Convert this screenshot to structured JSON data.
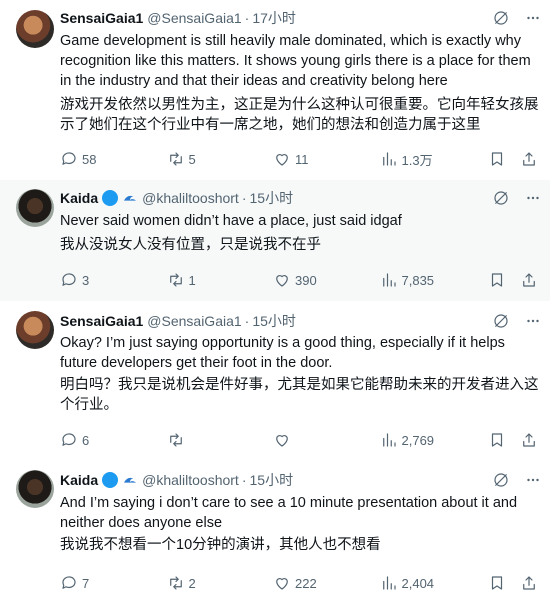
{
  "tweets": [
    {
      "name": "SensaiGaia1",
      "handle": "@SensaiGaia1",
      "dot": "·",
      "time": "17小时",
      "verified": false,
      "text": "Game development is still heavily male dominated, which is exactly why recognition like this matters. It shows young girls there is a place for them in the industry and that their ideas and creativity belong here",
      "translation": "游戏开发依然以男性为主，这正是为什么这种认可很重要。它向年轻女孩展示了她们在这个行业中有一席之地，她们的想法和创造力属于这里",
      "replies": "58",
      "retweets": "5",
      "likes": "11",
      "views": "1.3万"
    },
    {
      "name": "Kaida",
      "handle": "@khaliltooshort",
      "dot": "·",
      "time": "15小时",
      "verified": true,
      "text": "Never said women didn’t have a place, just said idgaf",
      "translation": "我从没说女人没有位置，只是说我不在乎",
      "replies": "3",
      "retweets": "1",
      "likes": "390",
      "views": "7,835"
    },
    {
      "name": "SensaiGaia1",
      "handle": "@SensaiGaia1",
      "dot": "·",
      "time": "15小时",
      "verified": false,
      "text": "Okay? I’m just saying opportunity is a good thing, especially if it helps future developers get their foot in the door.",
      "translation": "明白吗？我只是说机会是件好事，尤其是如果它能帮助未来的开发者进入这个行业。",
      "replies": "6",
      "retweets": "",
      "likes": "",
      "views": "2,769"
    },
    {
      "name": "Kaida",
      "handle": "@khaliltooshort",
      "dot": "·",
      "time": "15小时",
      "verified": true,
      "text": "And I’m saying i don’t care to see a 10 minute presentation about it and neither does anyone else",
      "translation": "我说我不想看一个10分钟的演讲，其他人也不想看",
      "replies": "7",
      "retweets": "2",
      "likes": "222",
      "views": "2,404"
    }
  ],
  "colors": {
    "text": "#0f1419",
    "secondary": "#536471",
    "verified": "#1d9bf0",
    "highlight_bg": "#f7f9f9"
  }
}
